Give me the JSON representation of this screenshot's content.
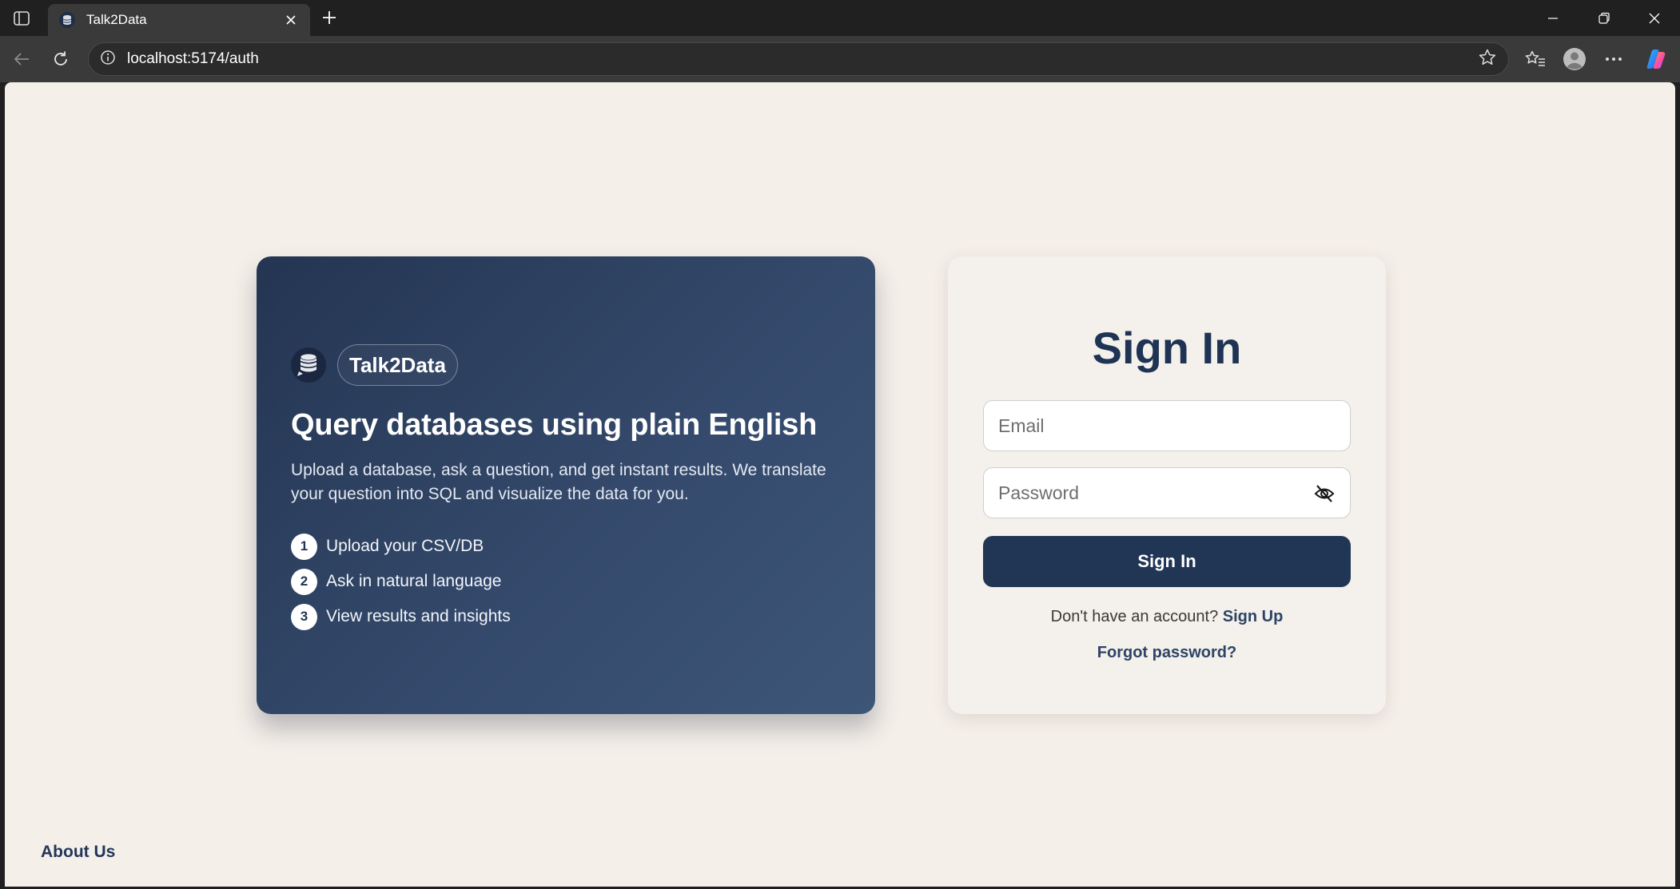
{
  "browser": {
    "tab_title": "Talk2Data",
    "url": "localhost:5174/auth"
  },
  "hero": {
    "brand": "Talk2Data",
    "heading": "Query databases using plain English",
    "description": "Upload a database, ask a question, and get instant results. We translate your question into SQL and visualize the data for you.",
    "steps": [
      {
        "num": "1",
        "text": "Upload your CSV/DB"
      },
      {
        "num": "2",
        "text": "Ask in natural language"
      },
      {
        "num": "3",
        "text": "View results and insights"
      }
    ]
  },
  "signin": {
    "title": "Sign In",
    "email_placeholder": "Email",
    "email_value": "",
    "password_placeholder": "Password",
    "password_value": "",
    "button_label": "Sign In",
    "no_account_text": "Don't have an account?",
    "signup_link": "Sign Up",
    "forgot_link": "Forgot password?"
  },
  "footer": {
    "about_link": "About Us"
  },
  "colors": {
    "page_bg": "#f5efe9",
    "hero_start": "#243552",
    "hero_end": "#3d5678",
    "primary": "#213554",
    "card_bg": "#f4f0eb"
  },
  "icons": {
    "tab_favicon": "database-icon",
    "brand_icon": "database-chat-icon",
    "password_toggle": "eye-off-icon"
  }
}
